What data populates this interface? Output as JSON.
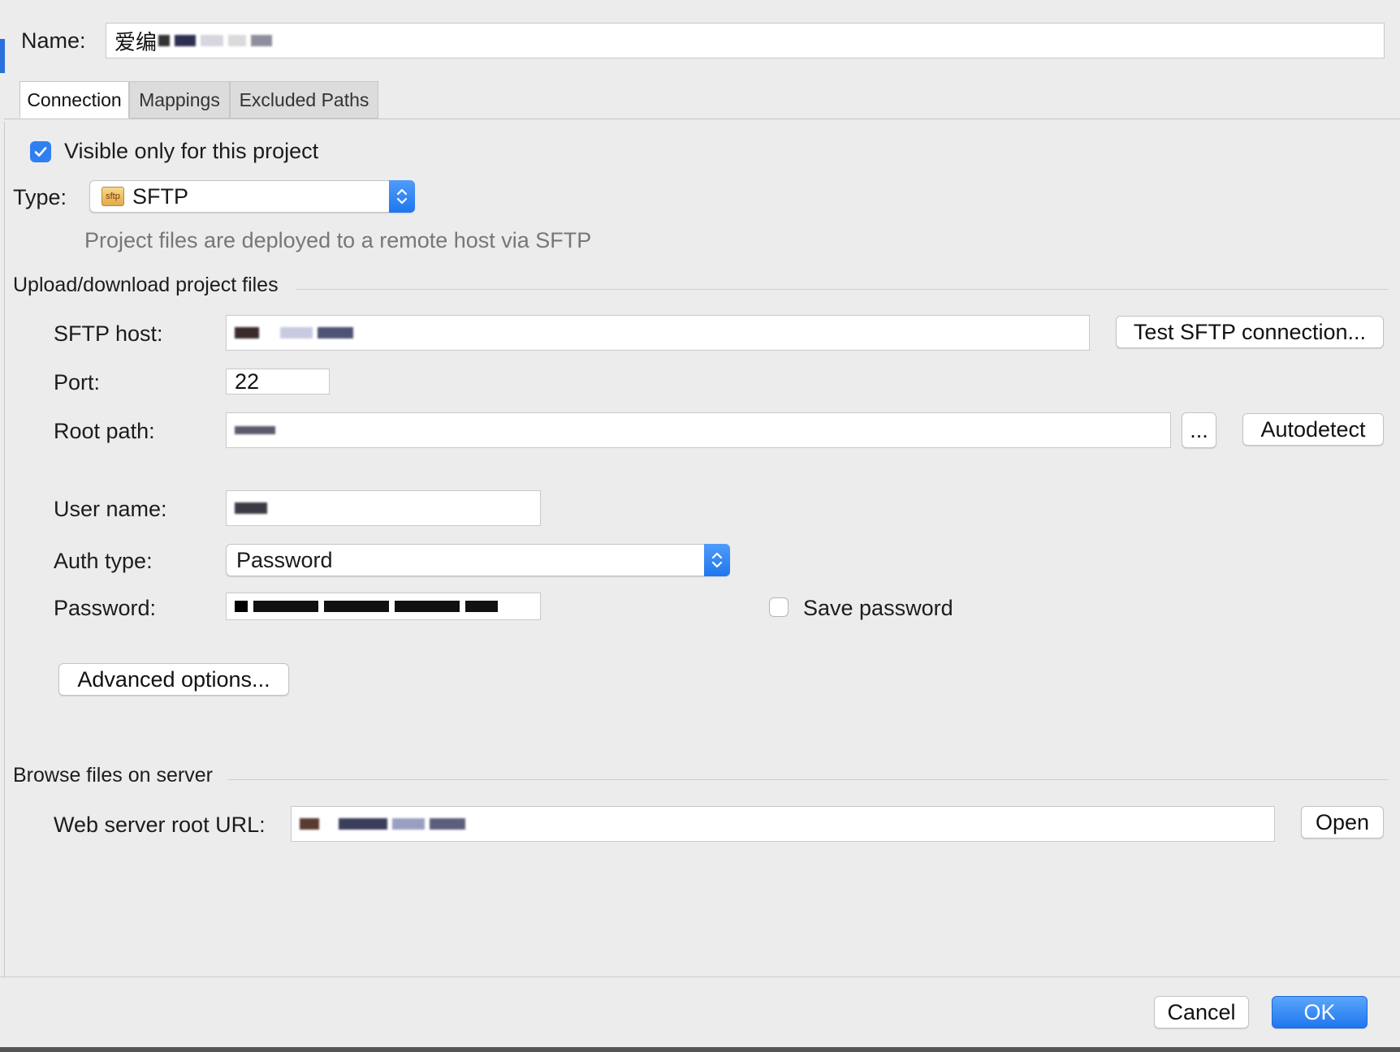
{
  "name_field": {
    "label": "Name:",
    "value": "爱编"
  },
  "tabs": [
    {
      "label": "Connection"
    },
    {
      "label": "Mappings"
    },
    {
      "label": "Excluded Paths"
    }
  ],
  "visible_only": {
    "label": "Visible only for this project",
    "checked": true
  },
  "type": {
    "label": "Type:",
    "value": "SFTP",
    "icon_text": "sftp",
    "description": "Project files are deployed to a remote host via SFTP"
  },
  "upload_section": {
    "title": "Upload/download project files"
  },
  "sftp_host": {
    "label": "SFTP host:",
    "test_button": "Test SFTP connection..."
  },
  "port": {
    "label": "Port:",
    "value": "22"
  },
  "root_path": {
    "label": "Root path:",
    "browse_button": "...",
    "autodetect_button": "Autodetect"
  },
  "user_name": {
    "label": "User name:"
  },
  "auth_type": {
    "label": "Auth type:",
    "value": "Password"
  },
  "password": {
    "label": "Password:",
    "save_label": "Save password",
    "save_checked": false
  },
  "advanced_button": "Advanced options...",
  "browse_section": {
    "title": "Browse files on server"
  },
  "web_root": {
    "label": "Web server root URL:",
    "open_button": "Open"
  },
  "footer": {
    "cancel": "Cancel",
    "ok": "OK"
  },
  "colors": {
    "accent": "#1f76ee",
    "checkbox_blue": "#2f7ff2",
    "background": "#ececec"
  }
}
